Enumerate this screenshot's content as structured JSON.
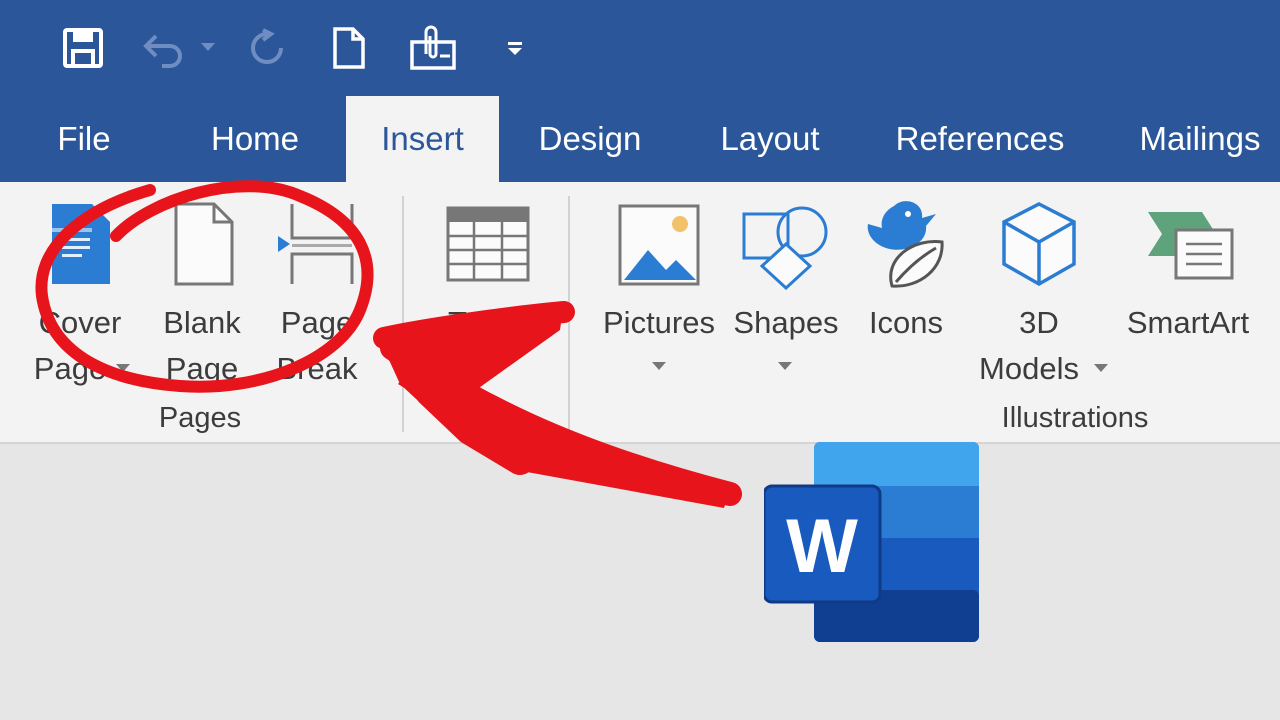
{
  "quick_access": {
    "icons": [
      "save-icon",
      "undo-icon",
      "undo-dropdown-icon",
      "redo-icon",
      "new-document-icon",
      "attach-icon",
      "customize-dropdown-icon"
    ]
  },
  "tabs": [
    {
      "label": "File"
    },
    {
      "label": "Home"
    },
    {
      "label": "Insert"
    },
    {
      "label": "Design"
    },
    {
      "label": "Layout"
    },
    {
      "label": "References"
    },
    {
      "label": "Mailings"
    }
  ],
  "active_tab": "Insert",
  "ribbon": {
    "pages_group": {
      "label": "Pages",
      "cover_page": {
        "line1": "Cover",
        "line2": "Page"
      },
      "blank_page": {
        "line1": "Blank",
        "line2": "Page"
      },
      "page_break": {
        "line1": "Page",
        "line2": "Break"
      }
    },
    "tables_group": {
      "label": "Tables",
      "table": {
        "line1": "Table"
      }
    },
    "illustrations_group": {
      "label": "Illustrations",
      "pictures": {
        "line1": "Pictures"
      },
      "shapes": {
        "line1": "Shapes"
      },
      "icons": {
        "line1": "Icons"
      },
      "models_3d": {
        "line1": "3D",
        "line2": "Models"
      },
      "smartart": {
        "line1": "SmartArt"
      }
    }
  },
  "colors": {
    "title_bar": "#2b579a",
    "ribbon": "#f3f3f3",
    "canvas": "#e6e6e6",
    "annotation_red": "#e8141c",
    "icon_blue": "#2b7cd3"
  },
  "overlay": {
    "annotation": "red circle and arrow highlighting Pages group",
    "logo": "Microsoft Word logo",
    "logo_letter": "W"
  }
}
